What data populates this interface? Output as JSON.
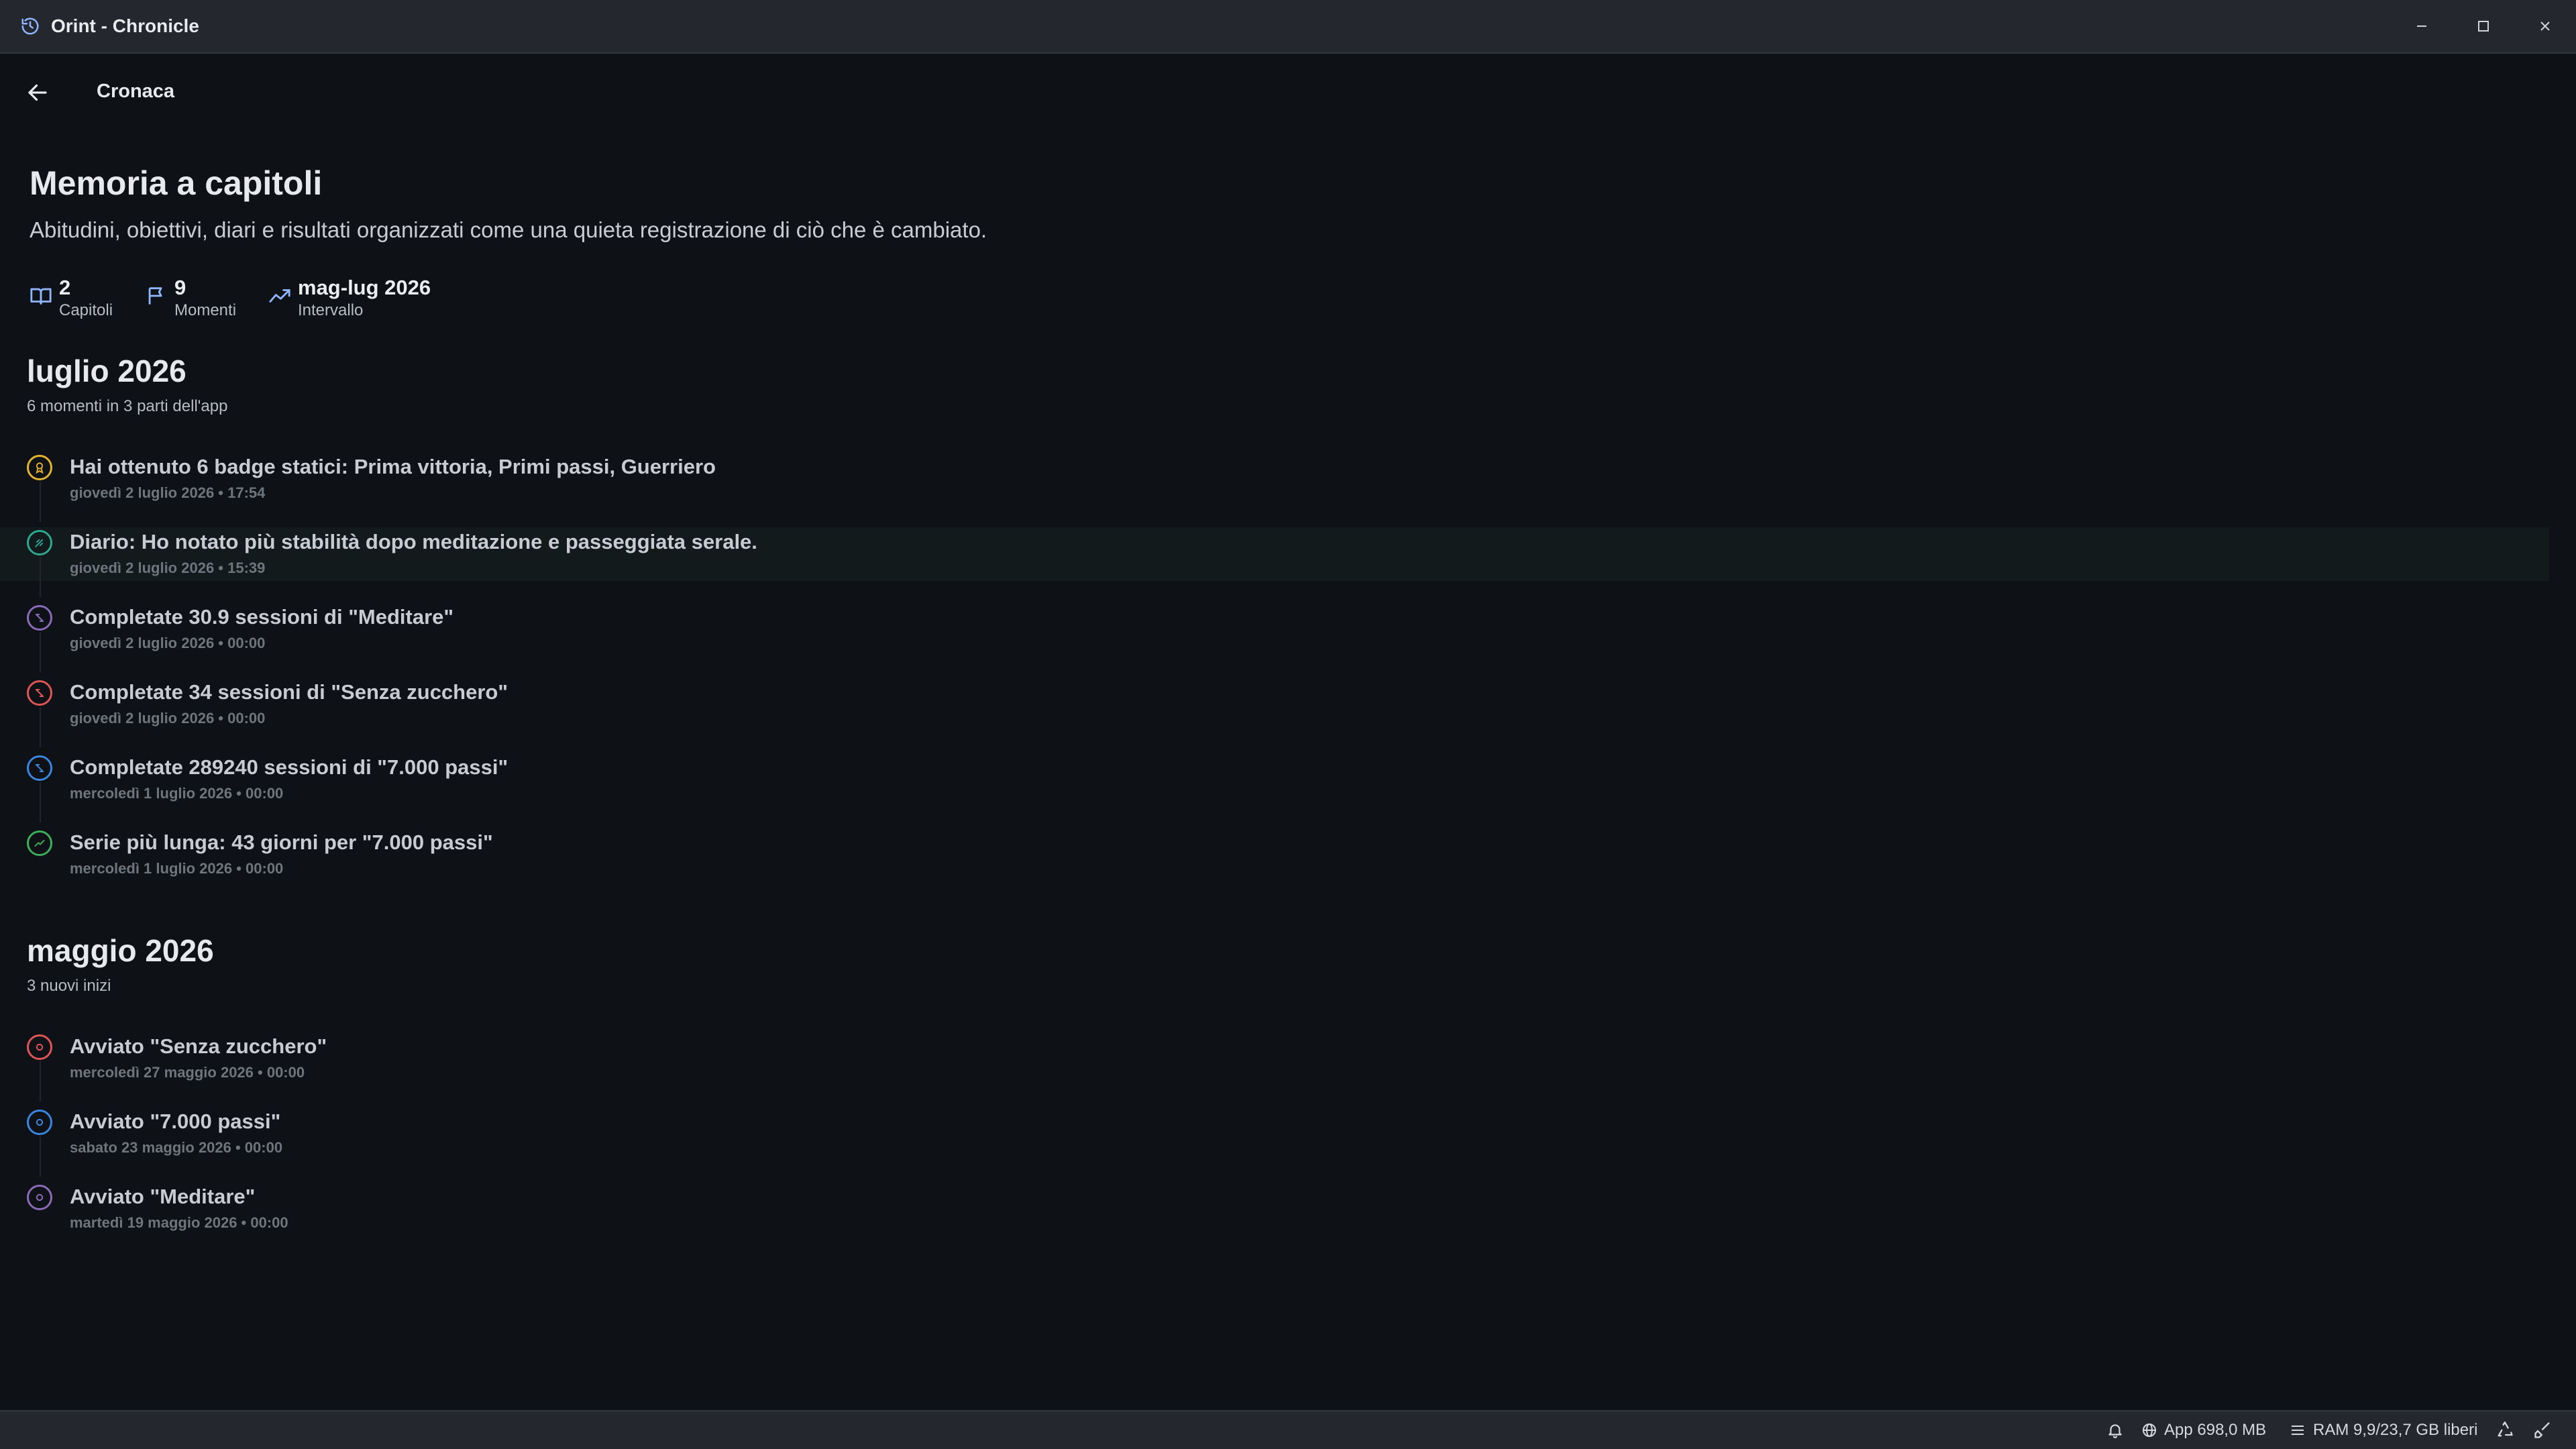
{
  "window": {
    "title": "Orint - Chronicle",
    "controls": [
      "minimize-icon",
      "maximize-icon",
      "close-icon"
    ]
  },
  "header": {
    "title": "Cronaca",
    "back_icon": "arrow-left-icon"
  },
  "hero": {
    "title": "Memoria a capitoli",
    "subtitle": "Abitudini, obiettivi, diari e risultati organizzati come una quieta registrazione di ciò che è cambiato."
  },
  "stats": [
    {
      "icon": "book-open-icon",
      "value": "2",
      "label": "Capitoli"
    },
    {
      "icon": "flag-icon",
      "value": "9",
      "label": "Momenti"
    },
    {
      "icon": "trend-icon",
      "value": "mag-lug 2026",
      "label": "Intervallo"
    }
  ],
  "colors": {
    "background": "#0e1116",
    "badge": "#e6b32e",
    "journal": "#2fa891",
    "meditate": "#8b6bb8",
    "sugar": "#e05656",
    "steps": "#3a86e0",
    "streak": "#3fae5a"
  },
  "months": [
    {
      "title": "luglio 2026",
      "subtitle": "6 momenti in 3 parti dell'app",
      "events": [
        {
          "icon": "badge-icon",
          "color": "#e6b32e",
          "title": "Hai ottenuto 6 badge statici: Prima vittoria, Primi passi, Guerriero",
          "date": "giovedì 2 luglio 2026 • 17:54"
        },
        {
          "icon": "journal-icon",
          "color": "#2fa891",
          "title": "Diario: Ho notato più stabilità dopo meditazione e passeggiata serale.",
          "date": "giovedì 2 luglio 2026 • 15:39",
          "highlight": true
        },
        {
          "icon": "repeat-icon",
          "color": "#8b6bb8",
          "title": "Completate 30.9 sessioni di \"Meditare\"",
          "date": "giovedì 2 luglio 2026 • 00:00"
        },
        {
          "icon": "repeat-icon",
          "color": "#e05656",
          "title": "Completate 34 sessioni di \"Senza zucchero\"",
          "date": "giovedì 2 luglio 2026 • 00:00"
        },
        {
          "icon": "repeat-icon",
          "color": "#3a86e0",
          "title": "Completate 289240 sessioni di \"7.000 passi\"",
          "date": "mercoledì 1 luglio 2026 • 00:00"
        },
        {
          "icon": "trend-up-icon",
          "color": "#3fae5a",
          "title": "Serie più lunga: 43 giorni per \"7.000 passi\"",
          "date": "mercoledì 1 luglio 2026 • 00:00"
        }
      ]
    },
    {
      "title": "maggio 2026",
      "subtitle": "3 nuovi inizi",
      "events": [
        {
          "icon": "start-icon",
          "color": "#e05656",
          "title": "Avviato \"Senza zucchero\"",
          "date": "mercoledì 27 maggio 2026 • 00:00"
        },
        {
          "icon": "start-icon",
          "color": "#3a86e0",
          "title": "Avviato \"7.000 passi\"",
          "date": "sabato 23 maggio 2026 • 00:00"
        },
        {
          "icon": "start-icon",
          "color": "#8b6bb8",
          "title": "Avviato \"Meditare\"",
          "date": "martedì 19 maggio 2026 • 00:00"
        }
      ]
    }
  ],
  "statusbar": {
    "bell_icon": "bell-icon",
    "app_memory": "App 698,0 MB",
    "ram": "RAM 9,9/23,7 GB liberi",
    "recycle_icon": "recycle-icon",
    "broom_icon": "broom-icon"
  }
}
